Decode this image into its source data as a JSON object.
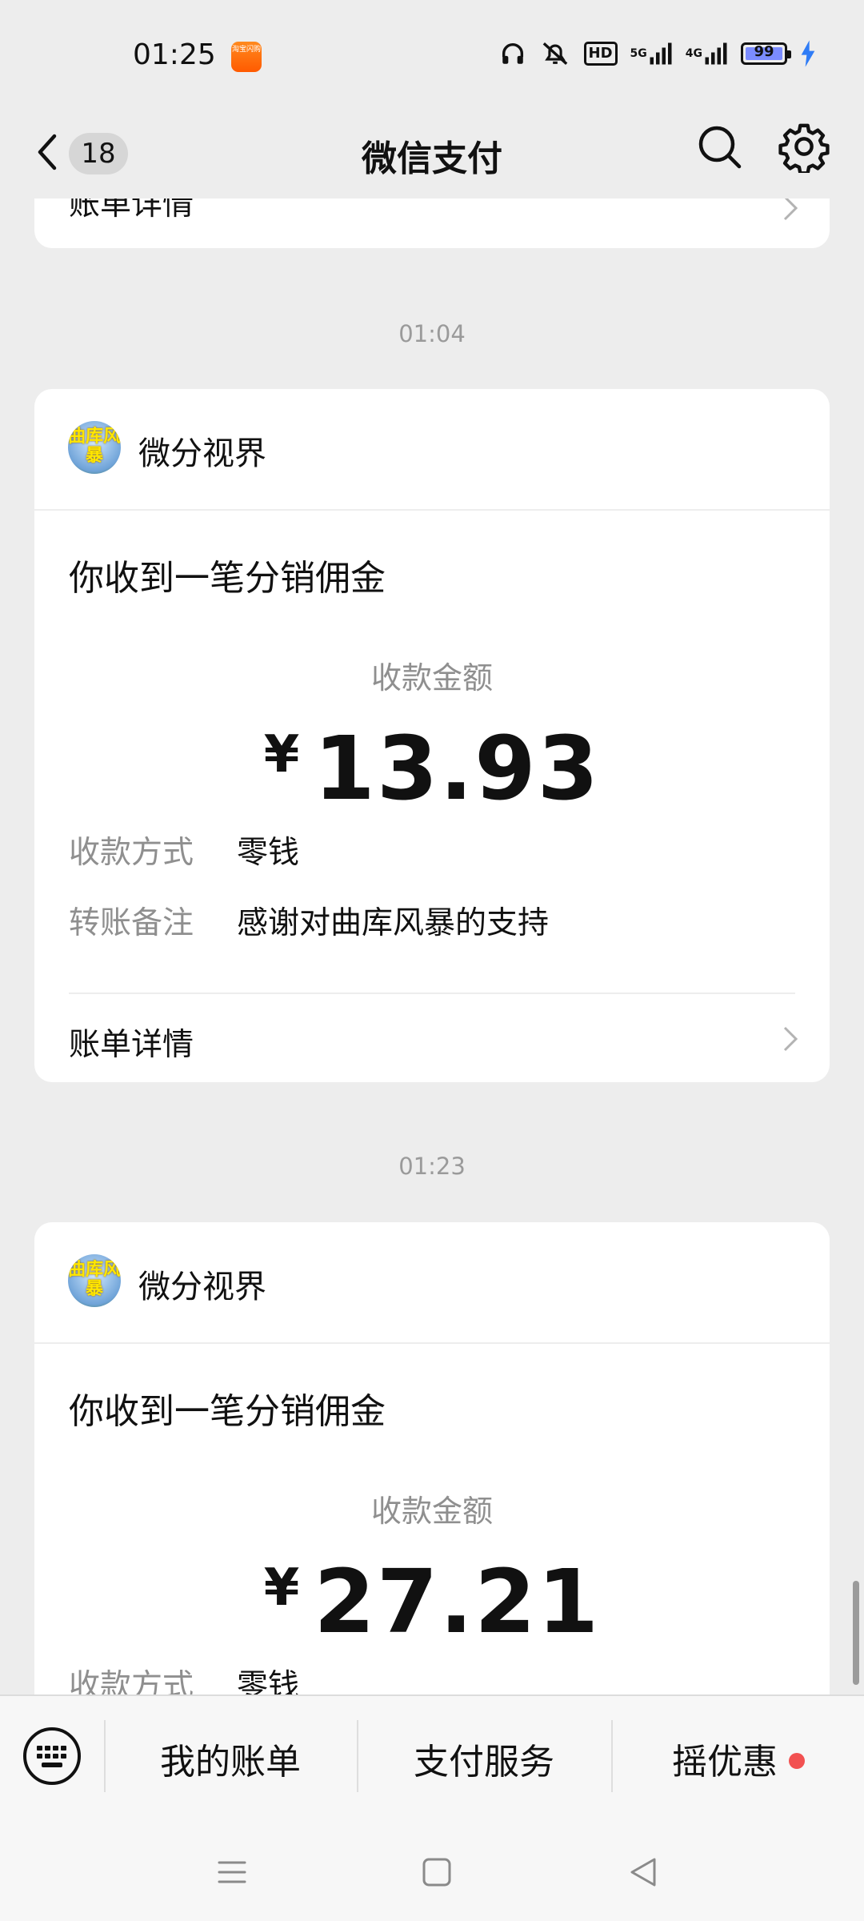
{
  "status": {
    "time": "01:25",
    "app_badge_text": "淘宝闪购",
    "hd_label": "HD",
    "net1": "5G",
    "net2": "4G",
    "battery": "99"
  },
  "header": {
    "unread_count": "18",
    "title": "微信支付"
  },
  "top_partial_card": {
    "detail_label": "账单详情"
  },
  "messages": [
    {
      "timestamp": "01:04",
      "sender": "微分视界",
      "avatar_text": "曲库风暴",
      "title": "你收到一笔分销佣金",
      "amount_label": "收款金额",
      "currency": "¥",
      "amount": "13.93",
      "method_key": "收款方式",
      "method_val": "零钱",
      "note_key": "转账备注",
      "note_val": "感谢对曲库风暴的支持",
      "detail_label": "账单详情"
    },
    {
      "timestamp": "01:23",
      "sender": "微分视界",
      "avatar_text": "曲库风暴",
      "title": "你收到一笔分销佣金",
      "amount_label": "收款金额",
      "currency": "¥",
      "amount": "27.21",
      "method_key": "收款方式",
      "method_val": "零钱"
    }
  ],
  "bottom_menu": {
    "items": [
      "我的账单",
      "支付服务",
      "摇优惠"
    ],
    "dot_color": "#f25151"
  }
}
